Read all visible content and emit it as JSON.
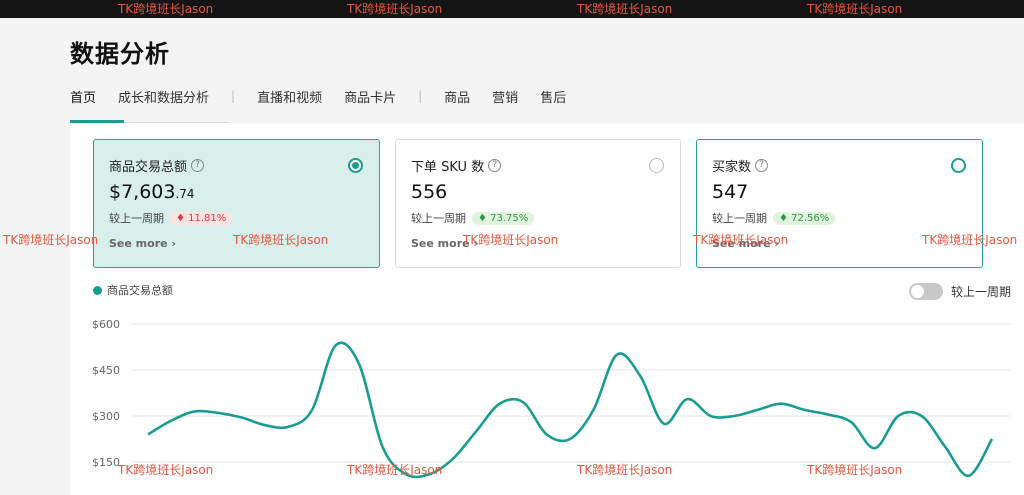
{
  "page": {
    "title": "数据分析"
  },
  "tabs": [
    {
      "label": "首页",
      "active": true
    },
    {
      "label": "成长和数据分析"
    },
    {
      "label": "直播和视频"
    },
    {
      "label": "商品卡片"
    },
    {
      "label": "商品"
    },
    {
      "label": "营销"
    },
    {
      "label": "售后"
    }
  ],
  "tab_separator": "|",
  "cards": [
    {
      "title": "商品交易总额",
      "value_main": "$7,603",
      "value_small": ".74",
      "compare_label": "较上一周期",
      "change": "11.81%",
      "change_arrow": "♦",
      "see_more": "See more",
      "selected": true
    },
    {
      "title": "下单 SKU 数",
      "value_main": "556",
      "compare_label": "较上一周期",
      "change": "73.75%",
      "change_arrow": "♦",
      "see_more": "See more",
      "selected": false
    },
    {
      "title": "买家数",
      "value_main": "547",
      "compare_label": "较上一周期",
      "change": "72.56%",
      "change_arrow": "♦",
      "see_more": "See more",
      "selected": false
    }
  ],
  "help_glyph": "?",
  "chevron_glyph": "›",
  "legend_label": "商品交易总额",
  "compare_toggle_label": "较上一周期",
  "watermark_text": "TK跨境班长Jason",
  "colors": {
    "accent": "#1b9c93",
    "negative": "#e3353c",
    "positive": "#2b9a3e",
    "watermark": "#e8563f"
  },
  "chart_data": {
    "type": "line",
    "series": [
      {
        "values": [
          240,
          285,
          315,
          310,
          295,
          270,
          265,
          320,
          530,
          470,
          200,
          110,
          110,
          160,
          250,
          340,
          345,
          240,
          225,
          320,
          500,
          430,
          275,
          355,
          300,
          300,
          320,
          340,
          320,
          305,
          280,
          195,
          300,
          300,
          200,
          105,
          225
        ]
      }
    ],
    "ylim": [
      150,
      600
    ],
    "yticks": [
      "$150",
      "$300",
      "$450",
      "$600"
    ],
    "ytick_values": [
      150,
      300,
      450,
      600
    ],
    "grid": true
  }
}
